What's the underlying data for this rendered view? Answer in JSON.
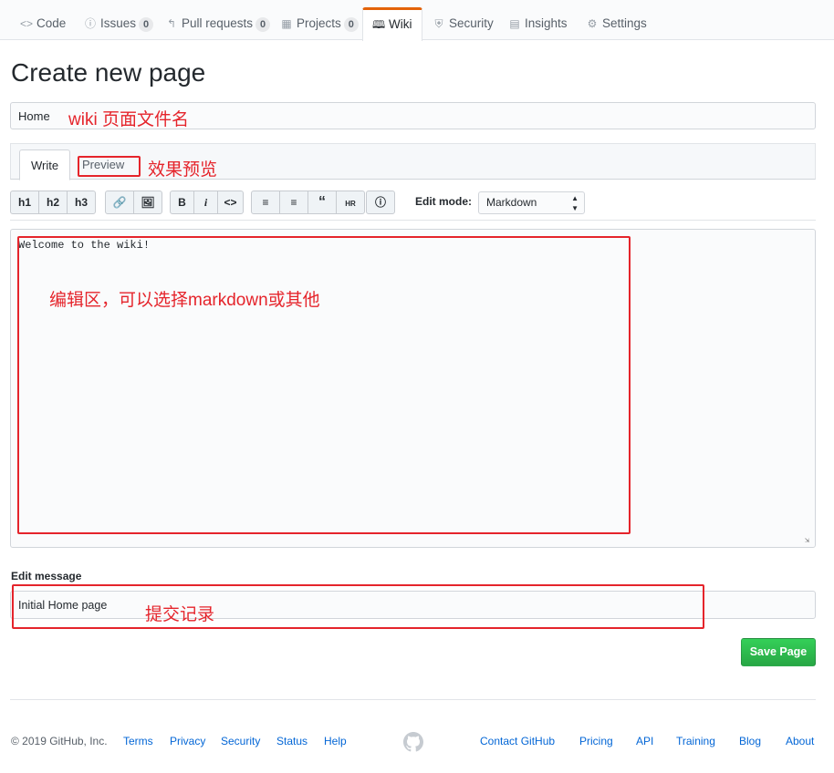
{
  "reponav": {
    "items": [
      {
        "label": "Code",
        "icon": "code-icon"
      },
      {
        "label": "Issues",
        "icon": "issue-icon",
        "count": "0"
      },
      {
        "label": "Pull requests",
        "icon": "pull-request-icon",
        "count": "0"
      },
      {
        "label": "Projects",
        "icon": "project-icon",
        "count": "0"
      },
      {
        "label": "Wiki",
        "icon": "book-icon",
        "selected": true
      },
      {
        "label": "Security",
        "icon": "shield-icon"
      },
      {
        "label": "Insights",
        "icon": "graph-icon"
      },
      {
        "label": "Settings",
        "icon": "gear-icon"
      }
    ]
  },
  "page": {
    "title": "Create new page",
    "name_value": "Home"
  },
  "tabs": {
    "write": "Write",
    "preview": "Preview"
  },
  "toolbar": {
    "h1": "h1",
    "h2": "h2",
    "h3": "h3",
    "bold": "B",
    "italic": "i",
    "code": "<>",
    "edit_mode_label": "Edit mode:",
    "edit_mode_value": "Markdown"
  },
  "editor": {
    "content": "Welcome to the wiki!"
  },
  "message": {
    "label": "Edit message",
    "value": "Initial Home page"
  },
  "save_button": "Save Page",
  "footer": {
    "copyright": "© 2019 GitHub, Inc.",
    "left_links": [
      "Terms",
      "Privacy",
      "Security",
      "Status",
      "Help"
    ],
    "right_links": [
      "Contact GitHub",
      "Pricing",
      "API",
      "Training",
      "Blog",
      "About"
    ]
  },
  "annotations": {
    "page_name": "wiki 页面文件名",
    "preview": "效果预览",
    "editor": "编辑区，可以选择markdown或其他",
    "commit": "提交记录"
  },
  "colors": {
    "accent_tab": "#e36209",
    "link": "#0366d6",
    "save_green": "#28a745",
    "annotation_red": "#e5242b"
  }
}
